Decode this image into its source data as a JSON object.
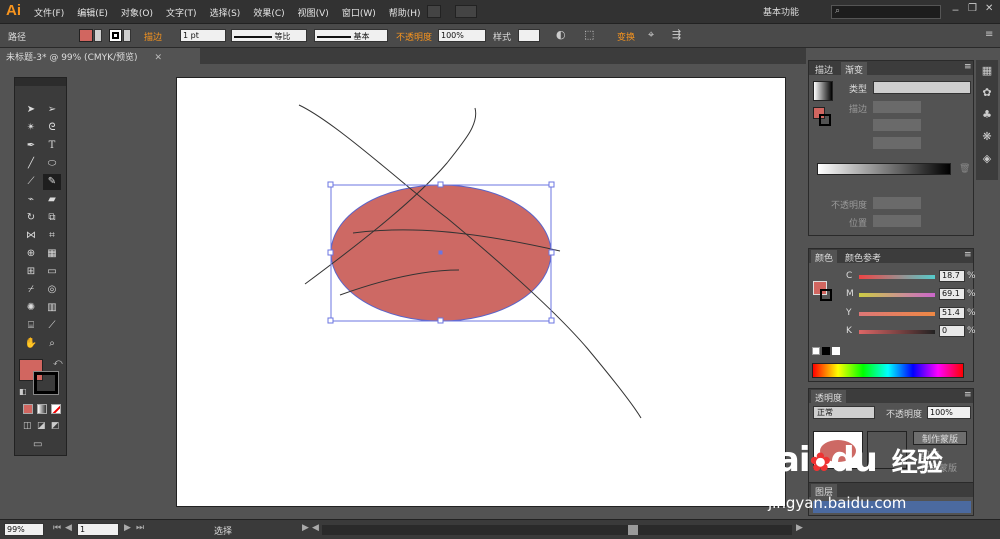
{
  "app": {
    "logo": "Ai",
    "menu": [
      "文件(F)",
      "编辑(E)",
      "对象(O)",
      "文字(T)",
      "选择(S)",
      "效果(C)",
      "视图(V)",
      "窗口(W)",
      "帮助(H)"
    ],
    "workspace": "基本功能"
  },
  "control": {
    "mode": "路径",
    "stroke_label": "描边",
    "stroke_weight": "1 pt",
    "profile_label": "等比",
    "brush_label": "基本",
    "opacity_label": "不透明度",
    "opacity_value": "100%",
    "style_label": "样式",
    "transform_label": "变换",
    "fill_color": "#d16660"
  },
  "document": {
    "tab_title": "未标题-3* @ 99% (CMYK/预览)",
    "close": "✕"
  },
  "artwork": {
    "ellipse_fill": "#cd6964",
    "ellipse_stroke": "#5b64c9",
    "selection_color": "#6b75e0"
  },
  "tools": {
    "fill_color": "#d16660"
  },
  "gradient": {
    "tab_stroke": "描边",
    "tab_gradient": "渐变",
    "type_label": "类型",
    "stroke_label": "描边",
    "opacity_label": "不透明度",
    "position_label": "位置"
  },
  "color": {
    "tab_color": "颜色",
    "tab_guide": "颜色参考",
    "c_label": "C",
    "c_value": "18.7",
    "m_label": "M",
    "m_value": "69.1",
    "y_label": "Y",
    "y_value": "51.4",
    "k_label": "K",
    "k_value": "0",
    "pct": "%"
  },
  "transparency": {
    "tab": "透明度",
    "blend": "正常",
    "opacity_label": "不透明度",
    "opacity_value": "100%",
    "make_mask": "制作蒙版",
    "clip": "剪切",
    "invert": "反相蒙版"
  },
  "layers": {
    "tab": "图层"
  },
  "status": {
    "zoom": "99%",
    "artboard": "1",
    "tool": "选择"
  },
  "watermark": {
    "brand": "Bai",
    "brand_du": "du",
    "jingyan": "经验",
    "url": "jingyan.baidu.com"
  }
}
